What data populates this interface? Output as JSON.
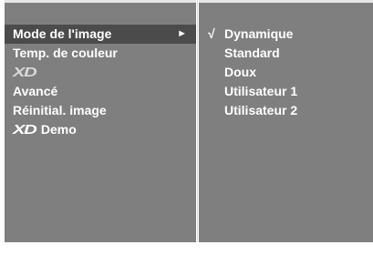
{
  "left_menu": {
    "items": [
      {
        "label": "Mode de l'image",
        "selected": true,
        "submenu_arrow": "►"
      },
      {
        "label": "Temp. de couleur"
      },
      {
        "label": "XD",
        "logo": true
      },
      {
        "label": "Avancé"
      },
      {
        "label": "Réinitial. image"
      },
      {
        "logo_label": "XD",
        "label": "Demo"
      }
    ]
  },
  "right_menu": {
    "check_mark": "√",
    "items": [
      {
        "label": "Dynamique",
        "checked": true
      },
      {
        "label": "Standard"
      },
      {
        "label": "Doux"
      },
      {
        "label": "Utilisateur 1"
      },
      {
        "label": "Utilisateur 2"
      }
    ]
  },
  "colors": {
    "panel_bg": "#7f7f7f",
    "selected_bg": "#4b4b4b",
    "text": "#ffffff"
  }
}
